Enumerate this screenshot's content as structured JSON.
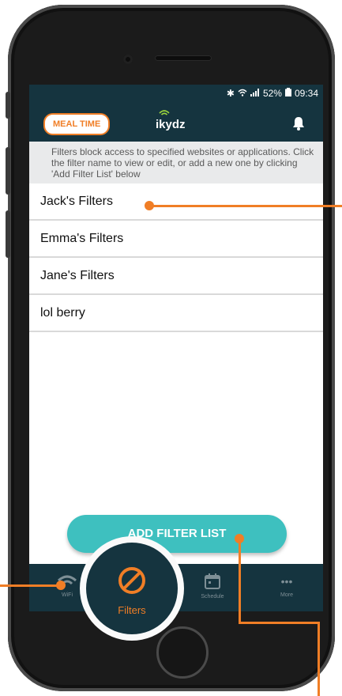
{
  "status_bar": {
    "battery_percent": "52%",
    "time": "09:34"
  },
  "header": {
    "mealtime_label": "MEAL TIME",
    "app_name": "ikydz",
    "bell_icon": "bell-icon"
  },
  "info_text": "Filters block access to specified websites or applications. Click the filter name to view or edit, or add a new one by clicking 'Add Filter List' below",
  "filters": [
    {
      "label": "Jack's Filters"
    },
    {
      "label": "Emma's Filters"
    },
    {
      "label": "Jane's Filters"
    },
    {
      "label": "lol berry"
    }
  ],
  "add_button_label": "ADD FILTER LIST",
  "tabs": [
    {
      "label": "WiFi",
      "icon": "wifi-icon"
    },
    {
      "label": "Filters",
      "icon": "block-icon"
    },
    {
      "label": "Schedule",
      "icon": "calendar-icon"
    },
    {
      "label": "More",
      "icon": "more-icon"
    }
  ],
  "colors": {
    "accent": "#f07e26",
    "header_bg": "#15343f",
    "button": "#3ec0bf"
  }
}
